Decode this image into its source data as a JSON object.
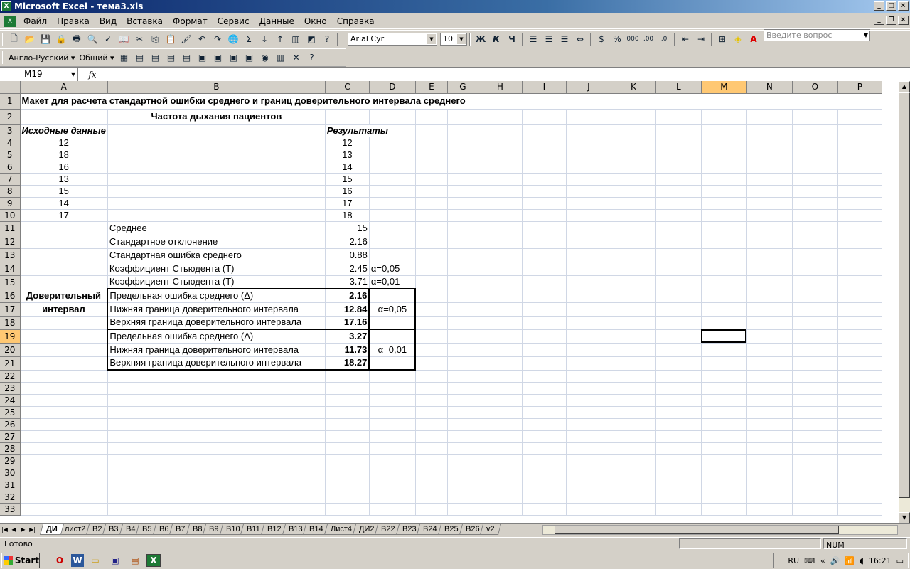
{
  "window": {
    "title": "Microsoft Excel - тема3.xls"
  },
  "menu": [
    "Файл",
    "Правка",
    "Вид",
    "Вставка",
    "Формат",
    "Сервис",
    "Данные",
    "Окно",
    "Справка"
  ],
  "help_placeholder": "Введите вопрос",
  "toolbar": {
    "font_name": "Arial Cyr",
    "font_size": "10",
    "bold": "Ж",
    "italic": "К",
    "underline": "Ч",
    "currency": "$",
    "percent": "%",
    "thousands": "000",
    "sum": "Σ",
    "dec_inc": ",00",
    "dec_dec": ",0"
  },
  "toolbar2": {
    "translator": "Англо-Русский",
    "style": "Общий"
  },
  "formula_bar": {
    "name_box": "M19",
    "fx": "fx",
    "formula": ""
  },
  "columns": [
    "A",
    "B",
    "C",
    "D",
    "E",
    "G",
    "H",
    "I",
    "J",
    "K",
    "L",
    "M",
    "N",
    "O",
    "P"
  ],
  "selected_column": "M",
  "selected_row": "19",
  "rows": {
    "r1": "Макет для расчета стандартной ошибки среднего и границ доверительного интервала среднего",
    "r2": "Частота дыхания пациентов",
    "r3a": "Исходные данные",
    "r3c": "Результаты",
    "source_data": [
      "12",
      "18",
      "16",
      "13",
      "15",
      "14",
      "17"
    ],
    "sorted_results": [
      "12",
      "13",
      "14",
      "15",
      "16",
      "17",
      "18"
    ],
    "stats": [
      {
        "label": "Среднее",
        "value": "15",
        "note": ""
      },
      {
        "label": "Стандартное отклонение",
        "value": "2.16",
        "note": ""
      },
      {
        "label": "Стандартная ошибка среднего",
        "value": "0.88",
        "note": ""
      },
      {
        "label": "Коэффициент Стьюдента (Т)",
        "value": "2.45",
        "note": "α=0,05"
      },
      {
        "label": "Коэффициент Стьюдента (Т)",
        "value": "3.71",
        "note": "α=0,01"
      }
    ],
    "ci_label_1": "Доверительный",
    "ci_label_2": "интервал",
    "ci_005": [
      {
        "label": "Предельная ошибка среднего (Δ)",
        "value": "2.16"
      },
      {
        "label": "Нижняя граница доверительного интервала",
        "value": "12.84"
      },
      {
        "label": "Верхняя граница доверительного интервала",
        "value": "17.16"
      }
    ],
    "alpha_005": "α=0,05",
    "ci_001": [
      {
        "label": "Предельная ошибка среднего (Δ)",
        "value": "3.27"
      },
      {
        "label": "Нижняя граница доверительного интервала",
        "value": "11.73"
      },
      {
        "label": "Верхняя граница доверительного интервала",
        "value": "18.27"
      }
    ],
    "alpha_001": "α=0,01"
  },
  "row_numbers": [
    "1",
    "2",
    "3",
    "4",
    "5",
    "6",
    "7",
    "8",
    "9",
    "10",
    "11",
    "12",
    "13",
    "14",
    "15",
    "16",
    "17",
    "18",
    "19",
    "20",
    "21",
    "22",
    "23",
    "24",
    "25",
    "26",
    "27",
    "28",
    "29",
    "30",
    "31",
    "32",
    "33"
  ],
  "sheet_tabs": [
    "ДИ",
    "лист2",
    "B2",
    "B3",
    "B4",
    "B5",
    "B6",
    "B7",
    "B8",
    "B9",
    "B10",
    "B11",
    "B12",
    "B13",
    "B14",
    "Лист4",
    "ДИ2",
    "B22",
    "B23",
    "B24",
    "B25",
    "B26",
    "v2"
  ],
  "status": {
    "ready": "Готово",
    "num": "NUM"
  },
  "taskbar": {
    "start": "Start",
    "lang": "RU",
    "clock": "16:21"
  }
}
